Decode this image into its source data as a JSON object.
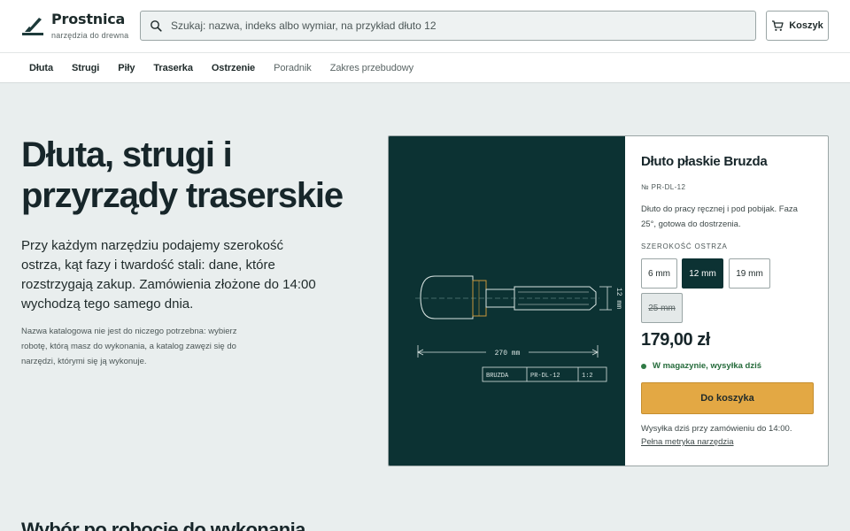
{
  "brand": {
    "name": "Prostnica",
    "tagline": "narzędzia do drewna"
  },
  "search": {
    "placeholder": "Szukaj: nazwa, indeks albo wymiar, na przykład dłuto 12",
    "icon": "search-icon"
  },
  "cart": {
    "label": "Koszyk",
    "icon": "cart-icon"
  },
  "nav": {
    "items": [
      {
        "label": "Dłuta"
      },
      {
        "label": "Strugi"
      },
      {
        "label": "Piły"
      },
      {
        "label": "Traserka"
      },
      {
        "label": "Ostrzenie"
      },
      {
        "label": "Poradnik"
      },
      {
        "label": "Zakres przebudowy"
      }
    ]
  },
  "hero": {
    "title": "Dłuta, strugi i przyrządy traserskie",
    "lead": "Przy każdym narzędziu podajemy szerokość ostrza, kąt fazy i twardość stali: dane, które rozstrzygają zakup. Zamówienia złożone do 14:00 wychodzą tego samego dnia.",
    "note": "Nazwa katalogowa nie jest do niczego potrzebna: wybierz robotę, którą masz do wykonania, a katalog zawęzi się do narzędzi, którymi się ją wykonuje."
  },
  "product": {
    "drawing": {
      "length_label": "270 mm",
      "width_label": "12 mm",
      "title_block": [
        "BRUZDA",
        "PR-DL-12",
        "1:2"
      ]
    },
    "title": "Dłuto płaskie Bruzda",
    "sku": "№ PR-DL-12",
    "description": "Dłuto do pracy ręcznej i pod pobijak. Faza 25°, gotowa do dostrzenia.",
    "size_label": "SZEROKOŚĆ OSTRZA",
    "sizes": [
      {
        "label": "6 mm",
        "state": "available"
      },
      {
        "label": "12 mm",
        "state": "selected"
      },
      {
        "label": "19 mm",
        "state": "available"
      },
      {
        "label": "25 mm",
        "state": "unavailable"
      }
    ],
    "price": "179,00 zł",
    "stock": "W magazynie, wysyłka dziś",
    "buy_label": "Do koszyka",
    "shipping_note": "Wysyłka dziś przy zamówieniu do 14:00.",
    "metrics_link": "Pełna metryka narzędzia"
  },
  "next_section": {
    "title": "Wybór po robocie do wykonania"
  },
  "colors": {
    "accent": "#e3a844",
    "dark": "#0c3233",
    "stock": "#2f7a45"
  }
}
